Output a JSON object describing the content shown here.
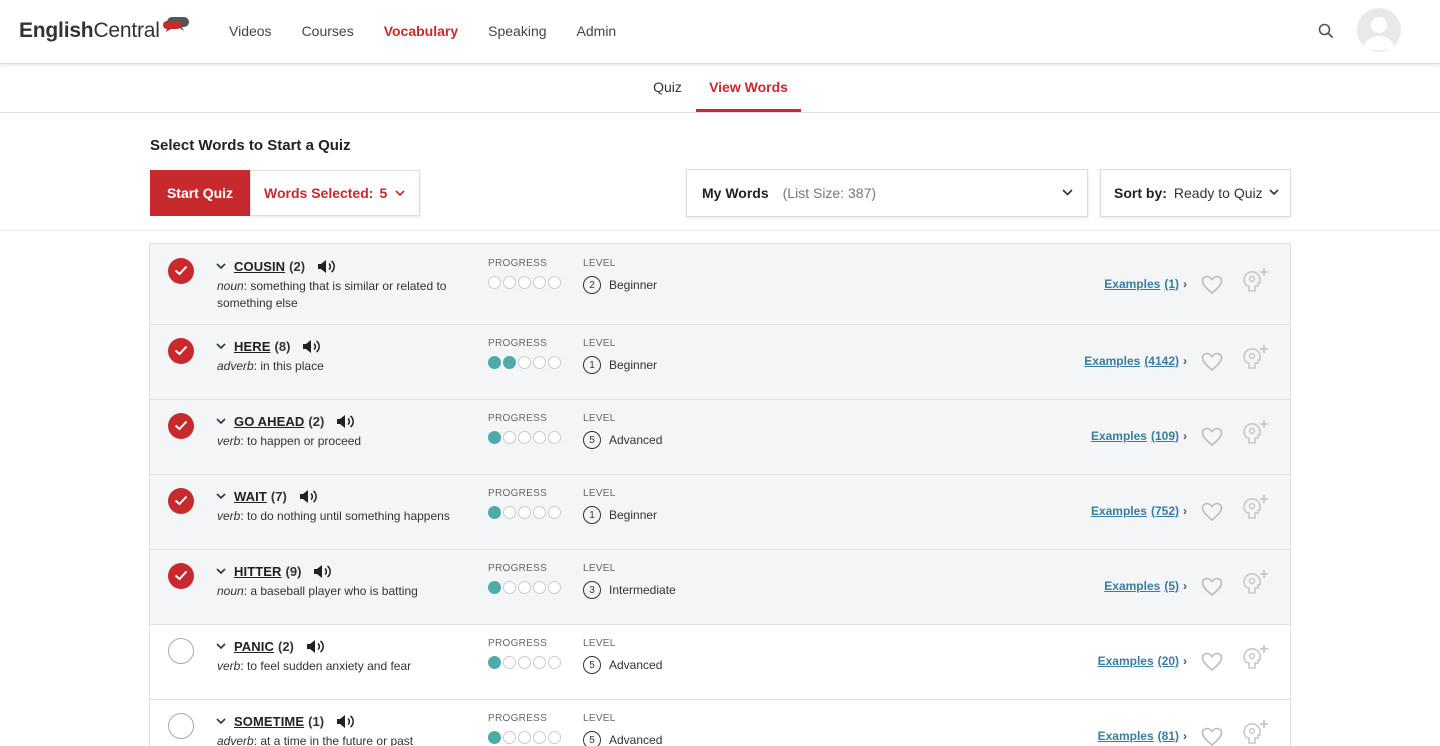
{
  "header": {
    "logo_bold": "English",
    "logo_rest": "Central",
    "nav": [
      "Videos",
      "Courses",
      "Vocabulary",
      "Speaking",
      "Admin"
    ],
    "active_nav": "Vocabulary"
  },
  "tabs": {
    "quiz": "Quiz",
    "view_words": "View Words"
  },
  "controls": {
    "section_title": "Select Words to Start a Quiz",
    "start_quiz": "Start Quiz",
    "words_selected_label": "Words Selected:",
    "words_selected_count": "5",
    "list_name": "My Words",
    "list_size": "(List Size: 387)",
    "sort_label": "Sort by:",
    "sort_value": "Ready to Quiz"
  },
  "labels": {
    "progress": "PROGRESS",
    "level": "LEVEL",
    "examples": "Examples"
  },
  "colors": {
    "accent": "#c62a2f",
    "progress": "#4eaba8",
    "link": "#3a7d9c"
  },
  "words": [
    {
      "word": "COUSIN",
      "count": "(2)",
      "pos": "noun",
      "definition": ": something that is similar or related to something else",
      "progress": 0,
      "level": "2",
      "level_name": "Beginner",
      "examples": "(1)",
      "selected": true
    },
    {
      "word": "HERE",
      "count": "(8)",
      "pos": "adverb",
      "definition": ": in this place",
      "progress": 2,
      "level": "1",
      "level_name": "Beginner",
      "examples": "(4142)",
      "selected": true
    },
    {
      "word": "GO AHEAD",
      "count": "(2)",
      "pos": "verb",
      "definition": ": to happen or proceed",
      "progress": 1,
      "level": "5",
      "level_name": "Advanced",
      "examples": "(109)",
      "selected": true
    },
    {
      "word": "WAIT",
      "count": "(7)",
      "pos": "verb",
      "definition": ": to do nothing until something happens",
      "progress": 1,
      "level": "1",
      "level_name": "Beginner",
      "examples": "(752)",
      "selected": true
    },
    {
      "word": "HITTER",
      "count": "(9)",
      "pos": "noun",
      "definition": ": a baseball player who is batting",
      "progress": 1,
      "level": "3",
      "level_name": "Intermediate",
      "examples": "(5)",
      "selected": true
    },
    {
      "word": "PANIC",
      "count": "(2)",
      "pos": "verb",
      "definition": ": to feel sudden anxiety and fear",
      "progress": 1,
      "level": "5",
      "level_name": "Advanced",
      "examples": "(20)",
      "selected": false
    },
    {
      "word": "SOMETIME",
      "count": "(1)",
      "pos": "adverb",
      "definition": ": at a time in the future or past",
      "progress": 1,
      "level": "5",
      "level_name": "Advanced",
      "examples": "(81)",
      "selected": false
    }
  ]
}
